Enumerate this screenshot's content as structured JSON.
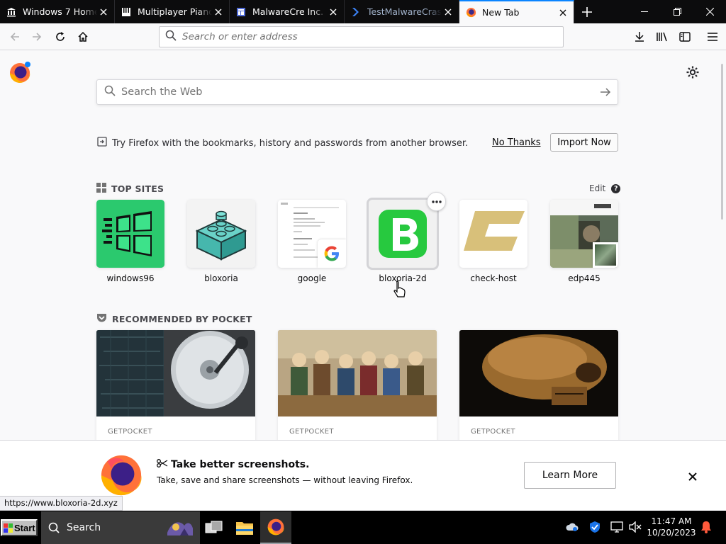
{
  "tabs": [
    {
      "title": "Windows 7 Home P",
      "icon": "bank-icon"
    },
    {
      "title": "Multiplayer Piano",
      "icon": "piano-icon"
    },
    {
      "title": "MalwareCre Inc. (b",
      "icon": "page-icon"
    },
    {
      "title": "TestMalwareCrashe",
      "icon": "chevron-logo-icon"
    },
    {
      "title": "New Tab",
      "icon": "firefox-icon",
      "active": true
    }
  ],
  "urlbar": {
    "placeholder": "Search or enter address"
  },
  "websearch": {
    "placeholder": "Search the Web"
  },
  "import": {
    "text": "Try Firefox with the bookmarks, history and passwords from another browser.",
    "no_thanks": "No Thanks",
    "import_now": "Import Now"
  },
  "top_sites": {
    "heading": "TOP SITES",
    "edit": "Edit",
    "help": "?",
    "sites": [
      {
        "label": "windows96"
      },
      {
        "label": "bloxoria"
      },
      {
        "label": "google"
      },
      {
        "label": "bloxoria-2d"
      },
      {
        "label": "check-host"
      },
      {
        "label": "edp445"
      }
    ]
  },
  "pocket": {
    "heading": "RECOMMENDED BY POCKET",
    "cards": [
      {
        "source": "GETPOCKET"
      },
      {
        "source": "GETPOCKET"
      },
      {
        "source": "GETPOCKET"
      }
    ]
  },
  "snippet": {
    "title": "Take better screenshots.",
    "text": "Take, save and share screenshots — without leaving Firefox.",
    "button": "Learn More"
  },
  "status_url": "https://www.bloxoria-2d.xyz",
  "taskbar": {
    "start": "Start",
    "search": "Search",
    "time": "11:47 AM",
    "date": "10/20/2023"
  },
  "colors": {
    "accent": "#0a84ff",
    "bloxoria_green": "#27c93f",
    "windows96_green": "#22c55e",
    "checkhost_gold": "#d8c07a"
  }
}
